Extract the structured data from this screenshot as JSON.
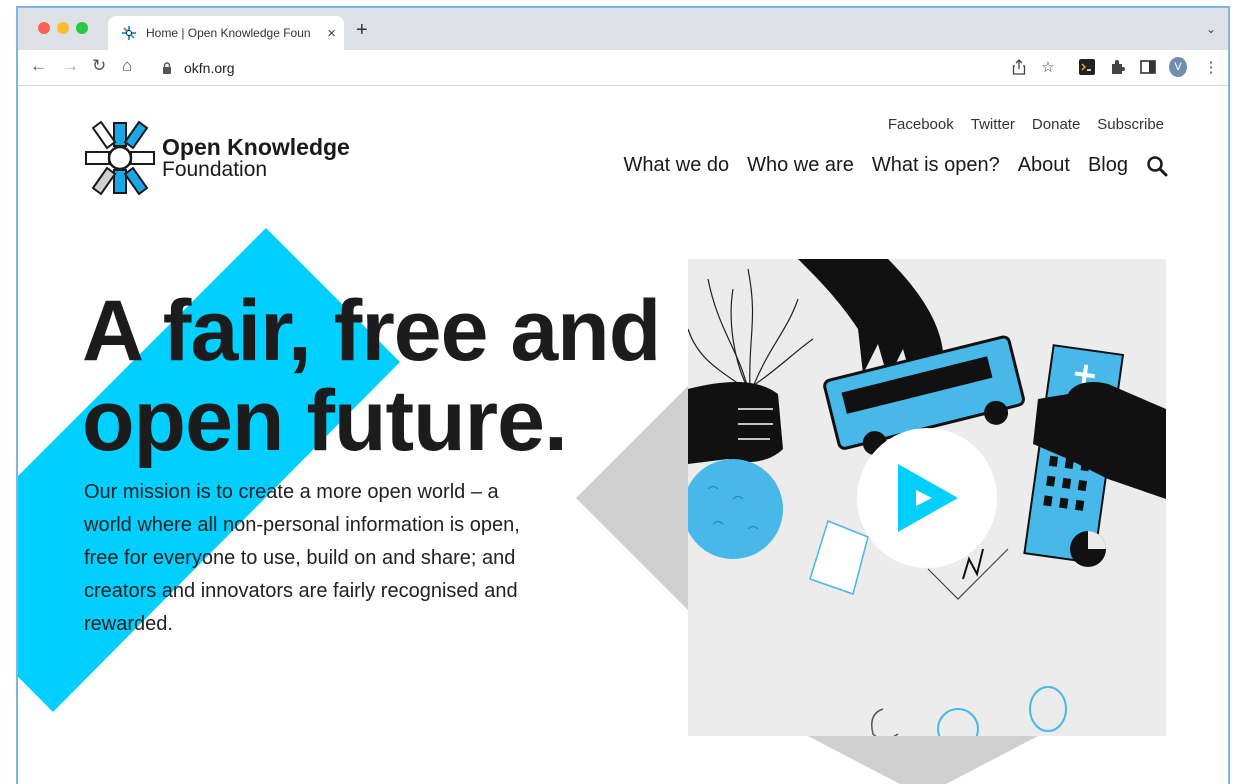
{
  "browser": {
    "tab_title": "Home | Open Knowledge Foun",
    "new_tab": "+",
    "close": "×",
    "tab_menu": "⌄",
    "url": "okfn.org",
    "profile_initial": "V"
  },
  "logo": {
    "line1": "Open Knowledge",
    "line2": "Foundation"
  },
  "top_nav": [
    "Facebook",
    "Twitter",
    "Donate",
    "Subscribe"
  ],
  "main_nav": [
    "What we do",
    "Who we are",
    "What is open?",
    "About",
    "Blog"
  ],
  "hero": {
    "title_line1": "A fair, free and",
    "title_line2": "open future.",
    "mission": "Our mission is to create a more open world – a world where all non-personal information is open, free for everyone to use, build on and share; and creators and innovators are fairly recognised and rewarded."
  },
  "colors": {
    "accent": "#00cfff",
    "text": "#1c1c1c",
    "logo_blue": "#1aa7e6"
  },
  "icons": [
    "back-icon",
    "forward-icon",
    "reload-icon",
    "home-icon",
    "lock-icon",
    "share-icon",
    "star-icon",
    "terminal-icon",
    "extensions-icon",
    "sidepanel-icon",
    "menu-icon",
    "search-icon",
    "play-icon"
  ]
}
